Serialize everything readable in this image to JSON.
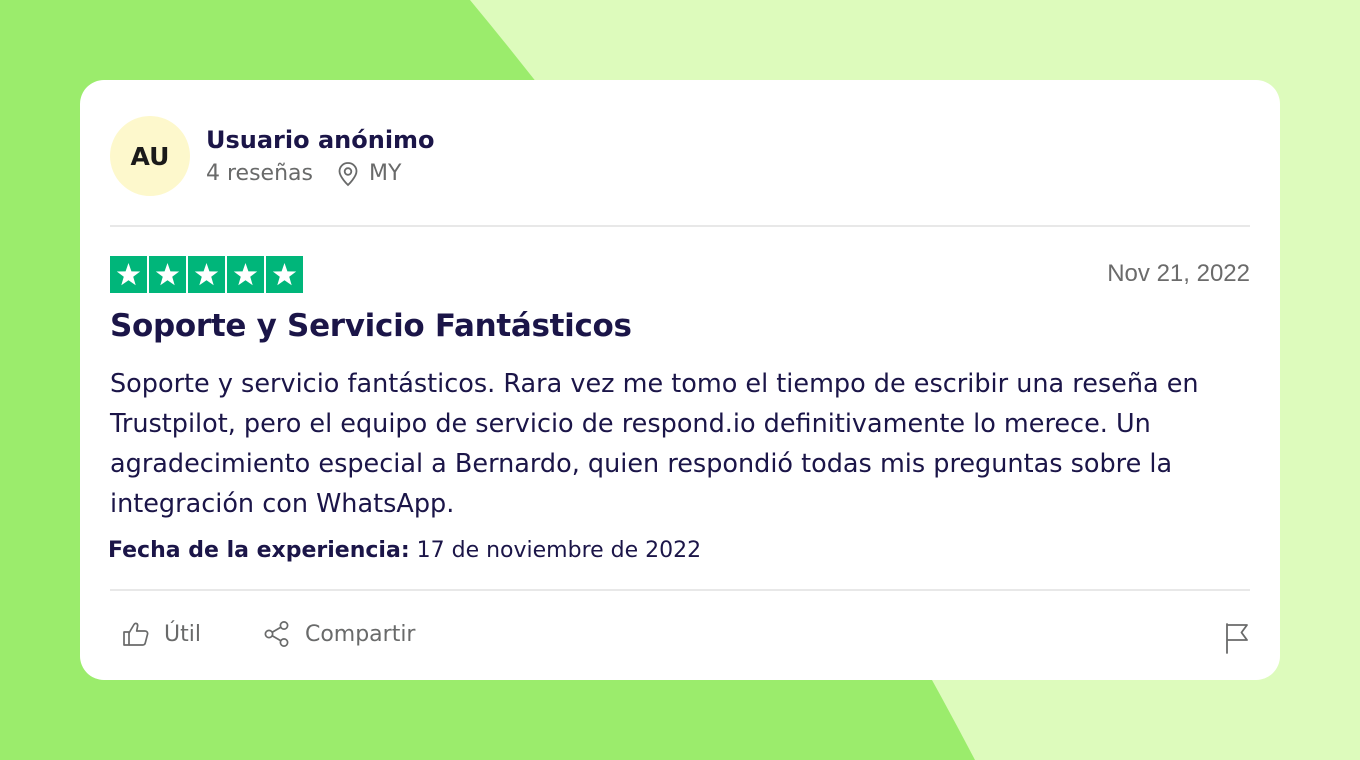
{
  "colors": {
    "background_light": "#ddfbbc",
    "background_shape": "#9bec6c",
    "card": "#ffffff",
    "avatar_bg": "#fdf8cc",
    "navy_text": "#1b1548",
    "gray_text": "#696a6a",
    "star_green": "#00b67a"
  },
  "reviewer": {
    "initials": "AU",
    "name": "Usuario anónimo",
    "reviews_count": "4 reseñas",
    "location_icon": "location-pin-icon",
    "country": "MY"
  },
  "review": {
    "rating": 5,
    "rating_max": 5,
    "date": "Nov 21, 2022",
    "title": "Soporte y Servicio Fantásticos",
    "text": "Soporte y servicio fantásticos. Rara vez me tomo el tiempo de escribir una reseña en Trustpilot, pero el equipo de servicio de respond.io definitivamente lo merece. Un agradecimiento especial a Bernardo, quien respondió todas mis preguntas sobre la integración con WhatsApp.",
    "experience_label": "Fecha de la experiencia:",
    "experience_date": "17 de noviembre de 2022"
  },
  "actions": {
    "useful_icon": "thumbs-up-icon",
    "useful_label": "Útil",
    "share_icon": "share-icon",
    "share_label": "Compartir",
    "flag_icon": "flag-icon"
  }
}
